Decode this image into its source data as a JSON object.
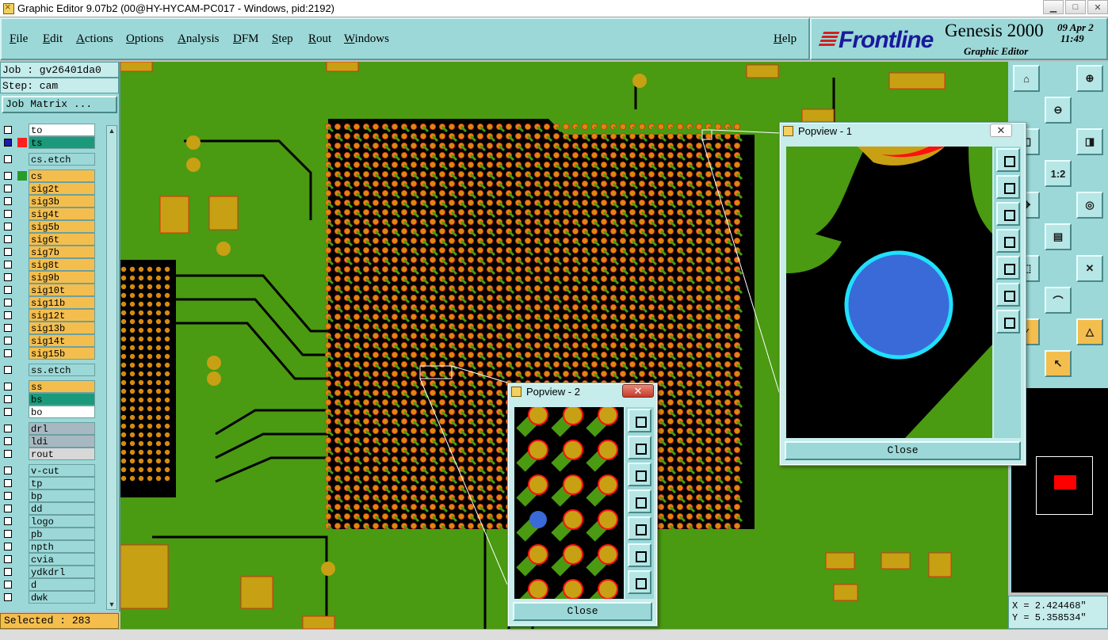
{
  "window": {
    "title": "Graphic Editor 9.07b2 (00@HY-HYCAM-PC017 - Windows, pid:2192)",
    "controls": [
      "▁",
      "□",
      "✕"
    ]
  },
  "menu": [
    "File",
    "Edit",
    "Actions",
    "Options",
    "Analysis",
    "DFM",
    "Step",
    "Rout",
    "Windows"
  ],
  "help": "Help",
  "brand": {
    "logo": "Frontline",
    "product": "Genesis 2000",
    "subtitle": "Graphic Editor",
    "date": "09  Apr  2",
    "time": "11:49"
  },
  "job": {
    "job_line": "Job : gv26401da0",
    "step_line": "Step: cam",
    "matrix_button": "Job Matrix ..."
  },
  "layers": [
    {
      "name": "to",
      "color": "#ffffff",
      "group": 1
    },
    {
      "name": "ts",
      "color": "#1a9a7a",
      "group": 1,
      "active": true
    },
    {
      "name": "cs.etch",
      "color": "#9cd8d8",
      "group": 2
    },
    {
      "name": "cs",
      "color": "#f4be4e",
      "group": 3
    },
    {
      "name": "sig2t",
      "color": "#f4be4e",
      "group": 3
    },
    {
      "name": "sig3b",
      "color": "#f4be4e",
      "group": 3
    },
    {
      "name": "sig4t",
      "color": "#f4be4e",
      "group": 3
    },
    {
      "name": "sig5b",
      "color": "#f4be4e",
      "group": 3
    },
    {
      "name": "sig6t",
      "color": "#f4be4e",
      "group": 3
    },
    {
      "name": "sig7b",
      "color": "#f4be4e",
      "group": 3
    },
    {
      "name": "sig8t",
      "color": "#f4be4e",
      "group": 3
    },
    {
      "name": "sig9b",
      "color": "#f4be4e",
      "group": 3
    },
    {
      "name": "sig10t",
      "color": "#f4be4e",
      "group": 3
    },
    {
      "name": "sig11b",
      "color": "#f4be4e",
      "group": 3
    },
    {
      "name": "sig12t",
      "color": "#f4be4e",
      "group": 3
    },
    {
      "name": "sig13b",
      "color": "#f4be4e",
      "group": 3
    },
    {
      "name": "sig14t",
      "color": "#f4be4e",
      "group": 3
    },
    {
      "name": "sig15b",
      "color": "#f4be4e",
      "group": 3
    },
    {
      "name": "ss.etch",
      "color": "#9cd8d8",
      "group": 4
    },
    {
      "name": "ss",
      "color": "#f4be4e",
      "group": 5
    },
    {
      "name": "bs",
      "color": "#1a9a7a",
      "group": 5
    },
    {
      "name": "bo",
      "color": "#ffffff",
      "group": 5
    },
    {
      "name": "drl",
      "color": "#a8b8c0",
      "group": 6
    },
    {
      "name": "ldi",
      "color": "#a8b8c0",
      "group": 6
    },
    {
      "name": "rout",
      "color": "#d8d8d8",
      "group": 6
    },
    {
      "name": "v-cut",
      "color": "#9cd8d8",
      "group": 7
    },
    {
      "name": "tp",
      "color": "#9cd8d8",
      "group": 7
    },
    {
      "name": "bp",
      "color": "#9cd8d8",
      "group": 7
    },
    {
      "name": "dd",
      "color": "#9cd8d8",
      "group": 7
    },
    {
      "name": "logo",
      "color": "#9cd8d8",
      "group": 7
    },
    {
      "name": "pb",
      "color": "#9cd8d8",
      "group": 7
    },
    {
      "name": "npth",
      "color": "#9cd8d8",
      "group": 7
    },
    {
      "name": "cvia",
      "color": "#9cd8d8",
      "group": 7
    },
    {
      "name": "ydkdrl",
      "color": "#9cd8d8",
      "group": 7
    },
    {
      "name": "d",
      "color": "#9cd8d8",
      "group": 7
    },
    {
      "name": "dwk",
      "color": "#9cd8d8",
      "group": 7
    }
  ],
  "status": {
    "selected": "Selected : 283",
    "x": "X = 2.424468\"",
    "y": "Y = 5.358534\""
  },
  "popview1": {
    "title": "Popview - 1",
    "close": "Close"
  },
  "popview2": {
    "title": "Popview - 2",
    "close": "Close"
  },
  "colors": {
    "board": "#4a9a12",
    "copper": "#000000",
    "pad": "#c8a014",
    "pad_ring": "#ff2020",
    "via": "#3a6ad8",
    "via_ring": "#20e0ff",
    "panel": "#9cd8d8"
  },
  "toolbar_icons": [
    "zoom-home-icon",
    "zoom-in-icon",
    "zoom-out-icon",
    "pan-left-icon",
    "pan-right-icon",
    "ratio-1-2-icon",
    "zoom-fit-icon",
    "probe-icon",
    "measure-ruler-icon",
    "select-icon",
    "cross-icon",
    "arc-icon",
    "line-icon",
    "triangle-icon",
    "pointer-icon"
  ]
}
